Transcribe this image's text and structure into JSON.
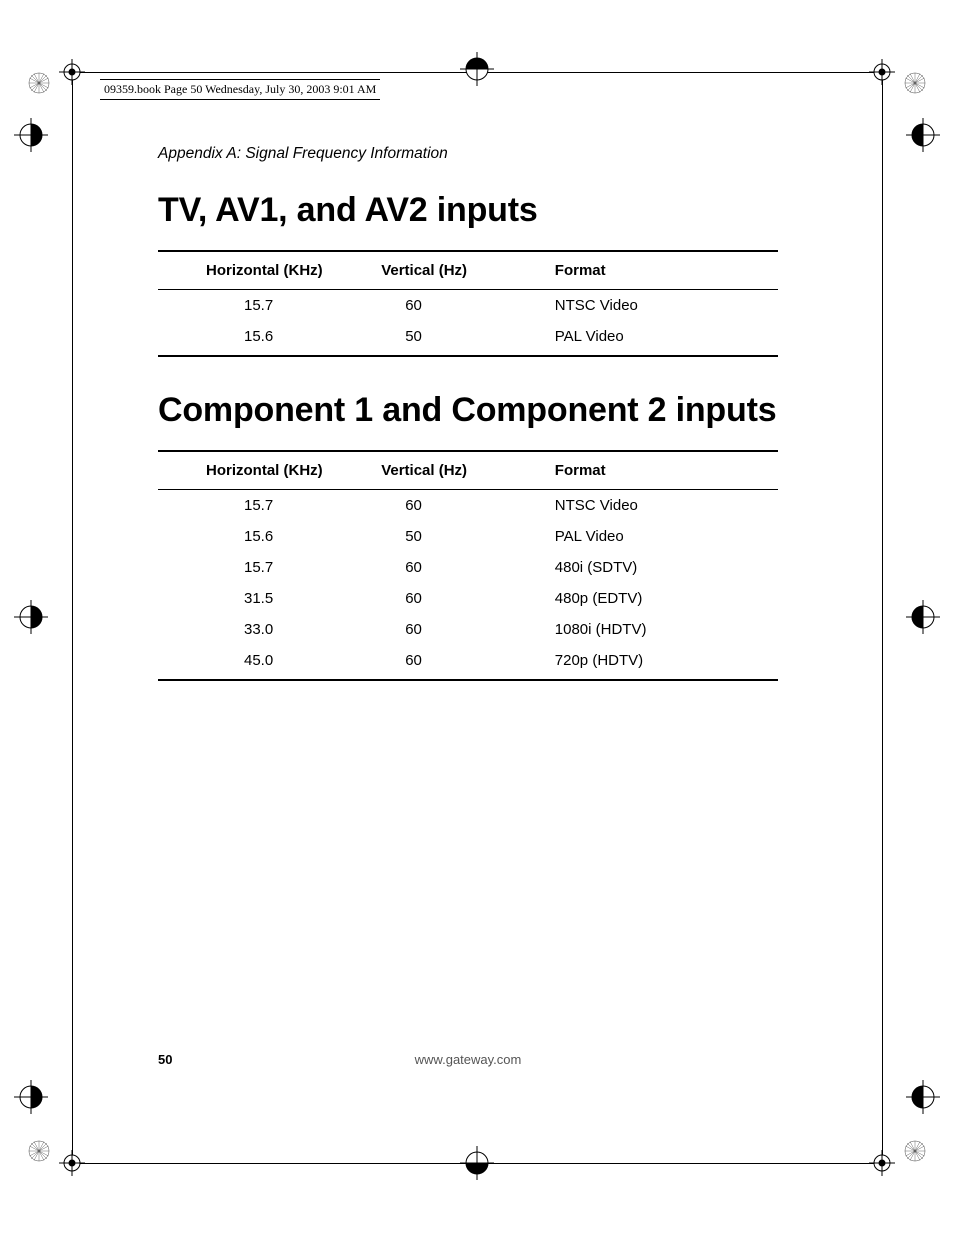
{
  "header_line": "09359.book  Page 50  Wednesday, July 30, 2003  9:01 AM",
  "appendix_label": "Appendix A: Signal Frequency Information",
  "section1_title": "TV, AV1, and AV2 inputs",
  "section2_title": "Component 1 and Component 2 inputs",
  "columns": {
    "c1": "Horizontal (KHz)",
    "c2": "Vertical (Hz)",
    "c3": "Format"
  },
  "table1": [
    {
      "h": "15.7",
      "v": "60",
      "f": "NTSC Video"
    },
    {
      "h": "15.6",
      "v": "50",
      "f": "PAL Video"
    }
  ],
  "table2": [
    {
      "h": "15.7",
      "v": "60",
      "f": "NTSC Video"
    },
    {
      "h": "15.6",
      "v": "50",
      "f": "PAL Video"
    },
    {
      "h": "15.7",
      "v": "60",
      "f": "480i (SDTV)"
    },
    {
      "h": "31.5",
      "v": "60",
      "f": "480p (EDTV)"
    },
    {
      "h": "33.0",
      "v": "60",
      "f": "1080i (HDTV)"
    },
    {
      "h": "45.0",
      "v": "60",
      "f": "720p (HDTV)"
    }
  ],
  "footer": {
    "page": "50",
    "url": "www.gateway.com"
  }
}
